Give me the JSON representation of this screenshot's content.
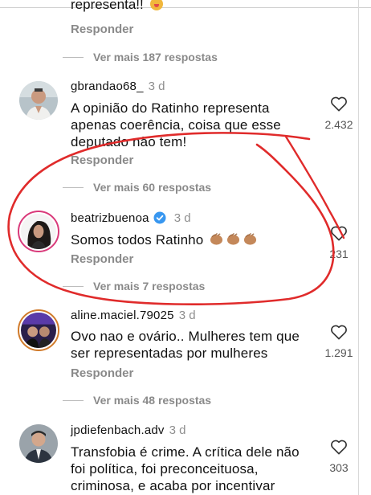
{
  "comments": [
    {
      "username": "",
      "time": "",
      "text": "representa!!",
      "reply_label": "Responder",
      "likes": ""
    },
    {
      "username": "gbrandao68_",
      "time": "3 d",
      "text": "A opinião do Ratinho representa apenas coerência,  coisa que esse deputado não tem!",
      "reply_label": "Responder",
      "likes": "2.432"
    },
    {
      "username": "beatrizbuenoa",
      "time": "3 d",
      "text": "Somos todos Ratinho",
      "reply_label": "Responder",
      "likes": "231",
      "verified": true
    },
    {
      "username": "aline.maciel.79025",
      "time": "3 d",
      "text": "Ovo nao e ovário.. Mulheres tem que ser representadas por mulheres",
      "reply_label": "Responder",
      "likes": "1.291"
    },
    {
      "username": "jpdiefenbach.adv",
      "time": "3 d",
      "text": "Transfobia é crime. A crítica dele não foi política, foi preconceituosa, criminosa, e acaba por incentivar",
      "reply_label": "",
      "likes": "303"
    }
  ],
  "more_replies": [
    "Ver mais 187 respostas",
    "Ver mais 60 respostas",
    "Ver mais 7 respostas",
    "Ver mais 48 respostas"
  ],
  "colors": {
    "annotation": "#e02b2b",
    "verified": "#3897f0",
    "muted": "#8e8e8e"
  },
  "icons": {
    "like": "heart-outline-icon",
    "verified": "verified-badge-icon",
    "clap": "clapping-hands-icon"
  }
}
